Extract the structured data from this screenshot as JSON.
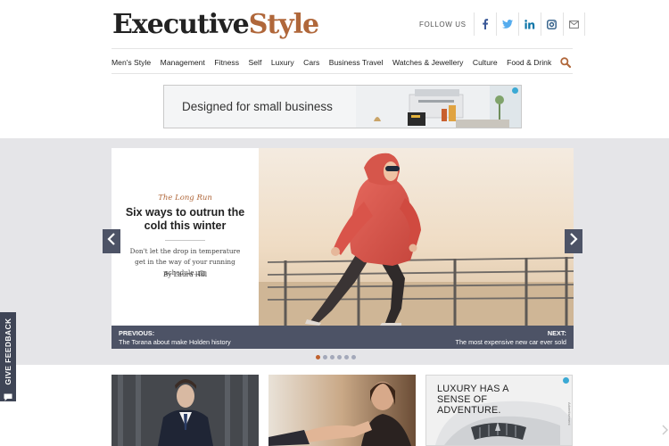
{
  "header": {
    "logo_part1": "Executive",
    "logo_part2": "Style",
    "follow_label": "FOLLOW US",
    "social_icons": [
      "facebook-icon",
      "twitter-icon",
      "linkedin-icon",
      "instagram-icon",
      "email-icon"
    ]
  },
  "nav": {
    "items": [
      "Men's Style",
      "Management",
      "Fitness",
      "Self",
      "Luxury",
      "Cars",
      "Business Travel",
      "Watches & Jewellery",
      "Culture",
      "Food & Drink"
    ],
    "search_icon": "search-icon"
  },
  "banner_ad": {
    "text": "Designed for small business"
  },
  "carousel": {
    "kicker": "The Long Run",
    "headline": "Six ways to outrun the cold this winter",
    "standfirst": "Don't let the drop in temperature get in the way of your running schedule.",
    "byline": "By Laura Hill",
    "previous_label": "PREVIOUS:",
    "previous_title": "The Torana about make Holden history",
    "next_label": "NEXT:",
    "next_title": "The most expensive new car ever sold",
    "slide_count": 6,
    "active_slide": 1
  },
  "feedback": {
    "label": "GIVE FEEDBACK"
  },
  "cards": {
    "ad_line1": "LUXURY HAS A",
    "ad_line2": "SENSE OF ADVENTURE.",
    "ad_tag": "Advertisement"
  },
  "colors": {
    "brand_accent": "#b0673a",
    "carousel_bar": "#4d5366",
    "band_bg": "#e5e5e8",
    "active_dot": "#c0622f"
  }
}
